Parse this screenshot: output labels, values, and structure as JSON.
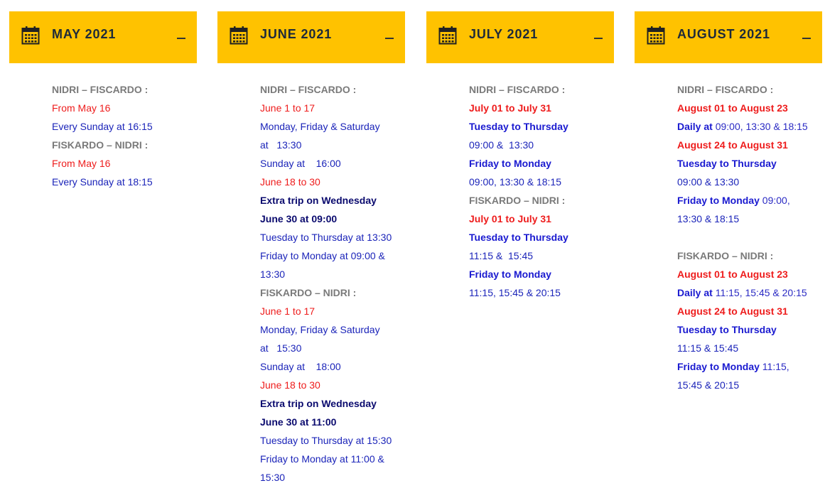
{
  "may": {
    "title": "MAY 2021",
    "route1": "NIDRI – FISCARDO :",
    "l1": "From May 16",
    "l2": "Every Sunday at 16:15",
    "route2": "FISKARDO – NIDRI :",
    "l3": "From May 16",
    "l4": "Every Sunday at 18:15"
  },
  "june": {
    "title": "JUNE 2021",
    "route1": "NIDRI – FISCARDO :",
    "a1": "June 1 to 17",
    "a2": "Monday, Friday & Saturday",
    "a3": "at   13:30",
    "a4": "Sunday at    16:00",
    "a5": "June 18 to 30",
    "a6": "Extra trip on Wednesday",
    "a7": "June 30 at 09:00",
    "a8": "Tuesday to Thursday at 13:30",
    "a9": "Friday to Monday at 09:00 &",
    "a10": "13:30",
    "route2": "FISKARDO – NIDRI :",
    "b1": "June 1 to 17",
    "b2": "Monday, Friday & Saturday",
    "b3": "at   15:30",
    "b4": "Sunday at    18:00",
    "b5": "June 18 to 30",
    "b6": "Extra trip on Wednesday",
    "b7": "June 30 at 11:00",
    "b8": "Tuesday to Thursday at 15:30",
    "b9": "Friday to Monday at 11:00 &",
    "b10": "15:30"
  },
  "july": {
    "title": "JULY 2021",
    "route1": "NIDRI – FISCARDO :",
    "a1": "July 01 to July 31",
    "a2": "Tuesday to Thursday",
    "a3": "09:00 &  13:30",
    "a4": "Friday to Monday",
    "a5": "09:00, 13:30 & 18:15",
    "route2": "FISKARDO – NIDRI :",
    "b1": "July 01 to July 31",
    "b2": "Tuesday to Thursday",
    "b3": "11:15 &  15:45",
    "b4": "Friday to Monday",
    "b5": "11:15, 15:45 & 20:15"
  },
  "august": {
    "title": "AUGUST 2021",
    "route1": "NIDRI – FISCARDO :",
    "a1": "August 01 to August 23",
    "a2_bold": "Daily at",
    "a2_rest": " 09:00, 13:30 & 18:15",
    "a3": "August 24 to August 31",
    "a4": "Tuesday to Thursday",
    "a5": "09:00 & 13:30",
    "a6_bold": "Friday to Monday",
    "a6_rest": " 09:00,",
    "a7": "13:30 & 18:15",
    "route2": "FISKARDO – NIDRI :",
    "b1": "August 01 to August 23",
    "b2_bold": "Daily at",
    "b2_rest": " 11:15, 15:45 & 20:15",
    "b3": "August 24 to August 31",
    "b4": "Tuesday to Thursday",
    "b5": "11:15 & 15:45",
    "b6_bold": "Friday to Monday",
    "b6_rest": " 11:15,",
    "b7": "15:45 & 20:15"
  }
}
